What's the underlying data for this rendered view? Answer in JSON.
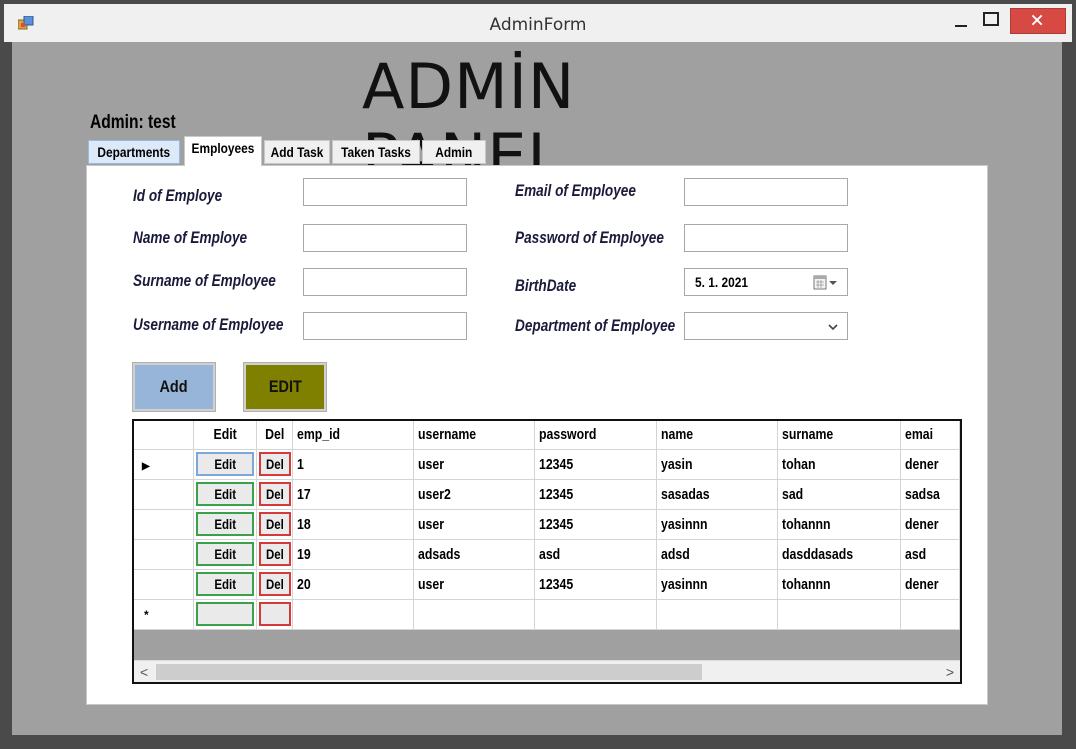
{
  "window": {
    "title": "AdminForm"
  },
  "header": {
    "title": "ADMİN PANEL",
    "admin_label": "Admin: test"
  },
  "tabs": [
    "Departments",
    "Employees",
    "Add Task",
    "Taken Tasks",
    "Admin"
  ],
  "active_tab": "Employees",
  "form": {
    "id_label": "Id of Employe",
    "name_label": "Name of Employe",
    "surname_label": "Surname of Employee",
    "username_label": "Username of Employee",
    "email_label": "Email of Employee",
    "password_label": "Password of Employee",
    "birthdate_label": "BirthDate",
    "birthdate_value": "5.  1.  2021",
    "department_label": "Department of Employee",
    "id_value": "",
    "name_value": "",
    "surname_value": "",
    "username_value": "",
    "email_value": "",
    "password_value": "",
    "department_value": ""
  },
  "buttons": {
    "add": "Add",
    "edit": "EDIT"
  },
  "buttons_colors": {
    "add": "#97b5d8",
    "edit": "#7f7f00"
  },
  "grid": {
    "columns": [
      "Edit",
      "Del",
      "emp_id",
      "username",
      "password",
      "name",
      "surname",
      "emai"
    ],
    "edit_label": "Edit",
    "del_label": "Del",
    "rows": [
      {
        "emp_id": "1",
        "username": "user",
        "password": "12345",
        "name": "yasin",
        "surname": "tohan",
        "email": "dener"
      },
      {
        "emp_id": "17",
        "username": "user2",
        "password": "12345",
        "name": "sasadas",
        "surname": "sad",
        "email": "sadsa"
      },
      {
        "emp_id": "18",
        "username": "user",
        "password": "12345",
        "name": "yasinnn",
        "surname": "tohannn",
        "email": "dener"
      },
      {
        "emp_id": "19",
        "username": "adsads",
        "password": "asd",
        "name": "adsd",
        "surname": "dasddasads",
        "email": "asd"
      },
      {
        "emp_id": "20",
        "username": "user",
        "password": "12345",
        "name": "yasinnn",
        "surname": "tohannn",
        "email": "dener"
      }
    ],
    "current_row_marker": "▶",
    "new_row_marker": "*"
  }
}
